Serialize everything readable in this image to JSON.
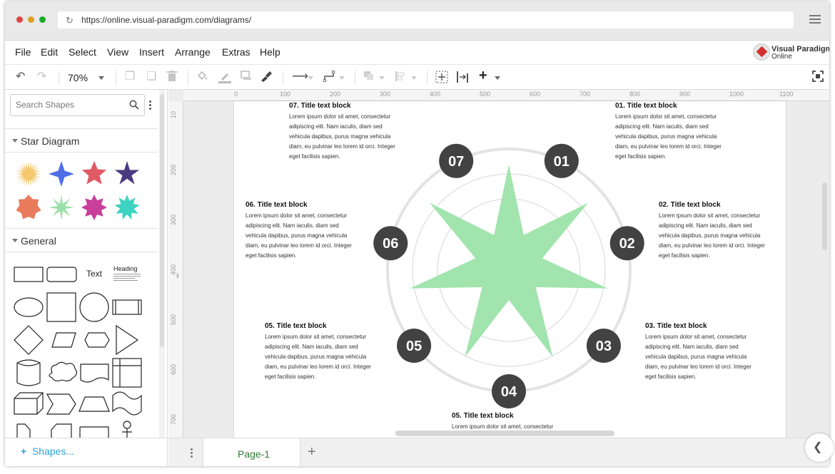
{
  "browser": {
    "url": "https://online.visual-paradigm.com/diagrams/",
    "traffic_colors": [
      "#e0443e",
      "#dea123",
      "#1aab29"
    ]
  },
  "menu": [
    "File",
    "Edit",
    "Select",
    "View",
    "Insert",
    "Arrange",
    "Extras",
    "Help"
  ],
  "brand": {
    "line1": "Visual Paradigm",
    "line2": "Online"
  },
  "toolbar": {
    "zoom": "70%"
  },
  "sidebar": {
    "search_placeholder": "Search Shapes",
    "sections": [
      "Star Diagram",
      "General"
    ],
    "star_colors": [
      "#f5c86e",
      "#4f6fe8",
      "#e05a64",
      "#4a3a80",
      "#ea7a5c",
      "#9be0a8",
      "#c8409b",
      "#3cd3c0"
    ],
    "general_text_label": "Text",
    "general_heading_label": "Heading",
    "more_shapes": "Shapes..."
  },
  "rulers": {
    "top": [
      "0",
      "100",
      "200",
      "300",
      "400",
      "500",
      "600",
      "700",
      "800",
      "900",
      "1000",
      "1100"
    ],
    "left": [
      "10",
      "200",
      "300",
      "400",
      "500",
      "600",
      "700"
    ]
  },
  "diagram": {
    "star_color": "#a1e4ad",
    "node_color": "#424242",
    "ring_color": "#e3e3e3",
    "nodes": [
      "01",
      "02",
      "03",
      "04",
      "05",
      "06",
      "07"
    ],
    "blocks": [
      {
        "title": "07. Title text block",
        "text": "Lorem ipsum dolor sit amet, consectetur\nadipiscing elit. Nam iaculis, diam sed\nvehicula dapibus, purus magna vehicula\ndiam, eu pulvinar leo lorem id orci. Integer\neget facilisis sapien."
      },
      {
        "title": "01. Title text block",
        "text": "Lorem ipsum dolor sit amet, consectetur\nadipiscing elit. Nam iaculis, diam sed\nvehicula dapibus, purus magna vehicula\ndiam, eu pulvinar leo lorem id orci. Integer\neget facilisis sapien."
      },
      {
        "title": "06. Title text block",
        "text": "Lorem ipsum dolor sit amet, consectetur\nadipiscing elit. Nam iaculis, diam sed\nvehicula dapibus, purus magna vehicula\ndiam, eu pulvinar leo lorem id orci. Integer\neget facilisis sapien."
      },
      {
        "title": "02. Title text block",
        "text": "Lorem ipsum dolor sit amet, consectetur\nadipiscing elit. Nam iaculis, diam sed\nvehicula dapibus, purus magna vehicula\ndiam, eu pulvinar leo lorem id orci. Integer\neget facilisis sapien."
      },
      {
        "title": "05. Title text block",
        "text": "Lorem ipsum dolor sit amet, consectetur\nadipiscing elit. Nam iaculis, diam sed\nvehicula dapibus, purus magna vehicula\ndiam, eu pulvinar leo lorem id orci. Integer\neget facilisis sapien."
      },
      {
        "title": "03. Title text block",
        "text": "Lorem ipsum dolor sit amet, consectetur\nadipiscing elit. Nam iaculis, diam sed\nvehicula dapibus, purus magna vehicula\ndiam, eu pulvinar leo lorem id orci. Integer\neget facilisis sapien."
      },
      {
        "title": "05. Title text block",
        "text": "Lorem ipsum dolor sit amet, consectetur"
      }
    ]
  },
  "pages": {
    "current": "Page-1"
  }
}
